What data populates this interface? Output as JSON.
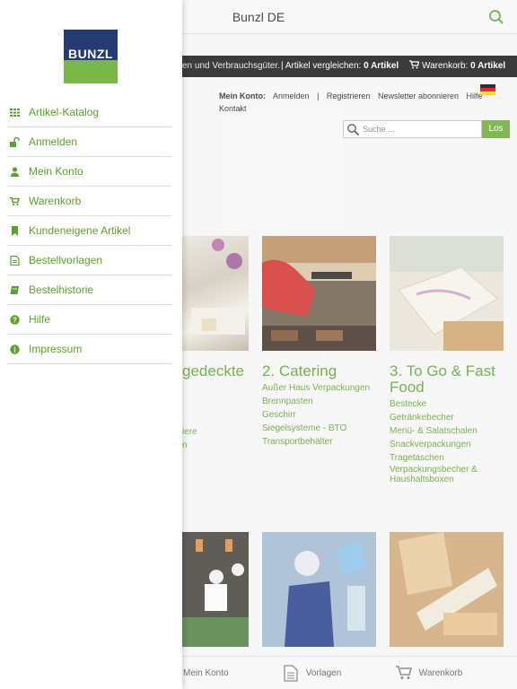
{
  "header": {
    "title": "Bunzl DE",
    "search_icon": "search-icon"
  },
  "infobar": {
    "tagline": "en und Verbrauchsgüter.",
    "compare_label": "| Artikel vergleichen:",
    "compare_value": "0 Artikel",
    "cart_label": "Warenkorb:",
    "cart_value": "0 Artikel"
  },
  "account": {
    "label": "Mein Konto:",
    "login": "Anmelden",
    "register": "Registrieren",
    "newsletter": "Newsletter abonnieren",
    "help": "Hilfe",
    "contact": "Kontakt",
    "separator": "|"
  },
  "search": {
    "placeholder": "Suche ...",
    "button": "Los"
  },
  "categories": [
    {
      "title": "gedeckte",
      "items": [
        "",
        "",
        "",
        "iere",
        "n"
      ]
    },
    {
      "title": "2. Catering",
      "items": [
        "Außer Haus Verpackungen",
        "Brennpasten",
        "Geschirr",
        "Siegelsysteme - BTO",
        "Transportbehälter"
      ]
    },
    {
      "title": "3. To Go & Fast Food",
      "items": [
        "Bestecke",
        "Getränkebecher",
        "Menü- & Salatschalen",
        "Snackverpackungen",
        "Tragetaschen",
        "Verpackungsbecher & Haushaltsboxen"
      ]
    }
  ],
  "tabbar": {
    "account": "Mein Konto",
    "templates": "Vorlagen",
    "cart": "Warenkorb"
  },
  "drawer": {
    "logo_text": "BUNZL",
    "items": [
      {
        "label": "Artikel-Katalog",
        "icon": "grid-icon"
      },
      {
        "label": "Anmelden",
        "icon": "unlock-icon"
      },
      {
        "label": "Mein Konto",
        "icon": "user-icon"
      },
      {
        "label": "Warenkorb",
        "icon": "cart-icon"
      },
      {
        "label": "Kundeneigene Artikel",
        "icon": "bookmark-icon"
      },
      {
        "label": "Bestellvorlagen",
        "icon": "document-icon"
      },
      {
        "label": "Bestelhistorie",
        "icon": "book-icon"
      },
      {
        "label": "Hilfe",
        "icon": "question-icon"
      },
      {
        "label": "Impressum",
        "icon": "info-icon"
      }
    ]
  },
  "colors": {
    "accent_green": "#5aa22b",
    "logo_blue": "#243b73",
    "logo_green": "#7ab648"
  }
}
